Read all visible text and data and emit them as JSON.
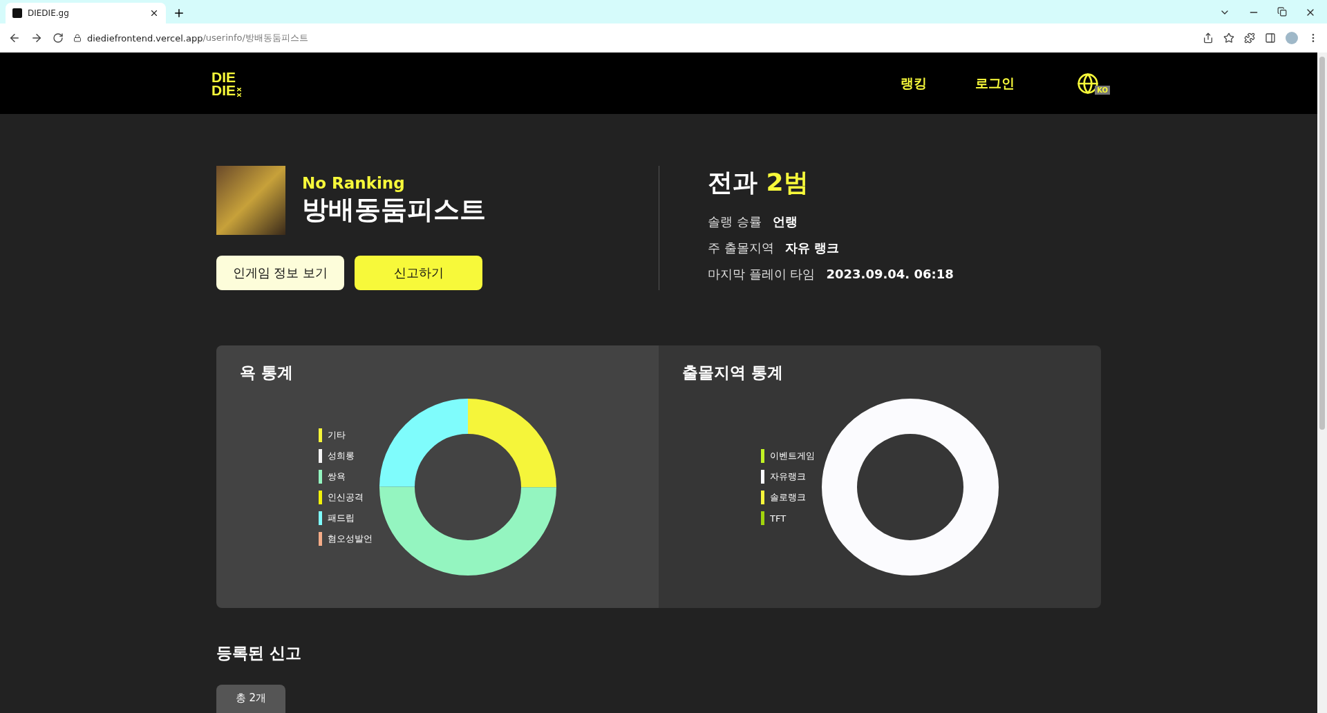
{
  "browser": {
    "tab": {
      "title": "DIEDIE.gg",
      "selected": true
    },
    "url": {
      "host": "diediefrontend.vercel.app",
      "path": "/userinfo/방배동둠피스트"
    }
  },
  "header": {
    "logo": {
      "lines": [
        "DIE",
        "DIE"
      ]
    },
    "nav": [
      {
        "label": "랭킹"
      },
      {
        "label": "로그인"
      }
    ],
    "language": "KO"
  },
  "profile": {
    "rank": "No Ranking",
    "name": "방배동둠피스트",
    "buttons": [
      {
        "label": "인게임 정보 보기",
        "kind": "secondary"
      },
      {
        "label": "신고하기",
        "kind": "primary"
      }
    ]
  },
  "record": {
    "label": "전과",
    "value": "2범",
    "rows": [
      {
        "label": "솔랭 승률",
        "value": "언랭"
      },
      {
        "label": "주 출몰지역",
        "value": "자유 랭크"
      },
      {
        "label": "마지막 플레이 타임",
        "value": "2023.09.04. 06:18"
      }
    ]
  },
  "charts": [
    {
      "title": "욕 통계",
      "legend": [
        {
          "label": "기타",
          "color": "#f5f53a"
        },
        {
          "label": "성희롱",
          "color": "#f4f4f4"
        },
        {
          "label": "쌍욕",
          "color": "#94f5c0"
        },
        {
          "label": "인신공격",
          "color": "#f2f20a"
        },
        {
          "label": "패드립",
          "color": "#7ffcfc"
        },
        {
          "label": "혐오성발언",
          "color": "#f5ac88"
        }
      ]
    },
    {
      "title": "출몰지역 통계",
      "legend": [
        {
          "label": "이벤트게임",
          "color": "#c2f224"
        },
        {
          "label": "자유랭크",
          "color": "#fbfbfe"
        },
        {
          "label": "솔로랭크",
          "color": "#f5f53a"
        },
        {
          "label": "TFT",
          "color": "#a2d40c"
        }
      ]
    }
  ],
  "reports": {
    "title": "등록된 신고",
    "count": "총 2개"
  }
}
